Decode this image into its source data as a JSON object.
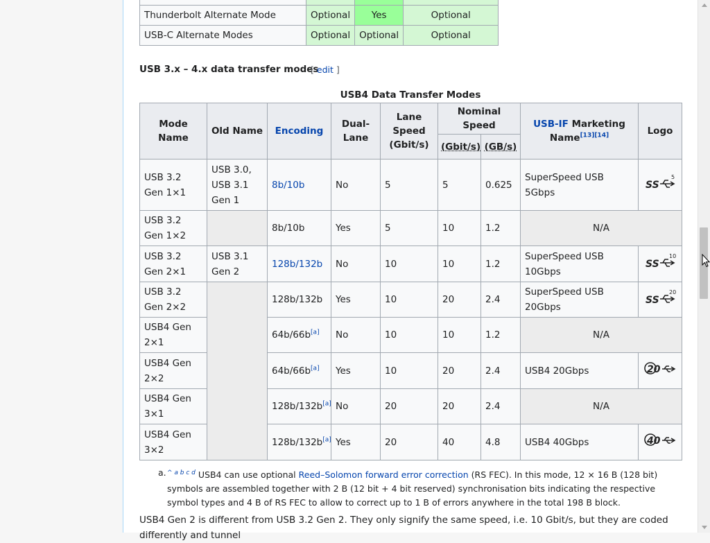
{
  "top_table": {
    "rows": [
      {
        "feature": "Thunderbolt Alternate Mode",
        "c1": "Optional",
        "c2": "Yes",
        "c3": "Optional"
      },
      {
        "feature": "USB-C Alternate Modes",
        "c1": "Optional",
        "c2": "Optional",
        "c3": "Optional"
      }
    ]
  },
  "section": {
    "heading": "USB 3.x – 4.x data transfer modes",
    "edit_open": "[",
    "edit_label": "edit",
    "edit_close": "]"
  },
  "usb_table": {
    "caption": "USB4 Data Transfer Modes",
    "headers": {
      "mode_name": "Mode Name",
      "old_name": "Old Name",
      "encoding": "Encoding",
      "dual_lane": "Dual-Lane",
      "lane_speed": "Lane Speed (Gbit/s)",
      "nominal_speed": "Nominal Speed",
      "gbits": "(Gbit/s)",
      "gbytes": "(GB/s)",
      "marketing_link": "USB-IF",
      "marketing_rest": "Marketing Name",
      "marketing_refs": "[13][14]",
      "logo": "Logo"
    },
    "na_label": "N/A",
    "rows": [
      {
        "mode": "USB 3.2 Gen 1×1",
        "old": "USB 3.0, USB 3.1 Gen 1",
        "enc": "8b/10b",
        "enc_ref": "",
        "dual": "No",
        "lane": "5",
        "gbit": "5",
        "gbyte": "0.625",
        "market": "SuperSpeed USB 5Gbps",
        "logo_num": "5"
      },
      {
        "mode": "USB 3.2 Gen 1×2",
        "old": "",
        "enc": "8b/10b",
        "enc_ref": "",
        "dual": "Yes",
        "lane": "5",
        "gbit": "10",
        "gbyte": "1.2",
        "market": "",
        "logo_num": ""
      },
      {
        "mode": "USB 3.2 Gen 2×1",
        "old": "USB 3.1 Gen 2",
        "enc": "128b/132b",
        "enc_ref": "",
        "dual": "No",
        "lane": "10",
        "gbit": "10",
        "gbyte": "1.2",
        "market": "SuperSpeed USB 10Gbps",
        "logo_num": "10"
      },
      {
        "mode": "USB 3.2 Gen 2×2",
        "old": "",
        "enc": "128b/132b",
        "enc_ref": "",
        "dual": "Yes",
        "lane": "10",
        "gbit": "20",
        "gbyte": "2.4",
        "market": "SuperSpeed USB 20Gbps",
        "logo_num": "20"
      },
      {
        "mode": "USB4 Gen 2×1",
        "old": "",
        "enc": "64b/66b",
        "enc_ref": "[a]",
        "dual": "No",
        "lane": "10",
        "gbit": "10",
        "gbyte": "1.2",
        "market": "",
        "logo_num": ""
      },
      {
        "mode": "USB4 Gen 2×2",
        "old": "",
        "enc": "64b/66b",
        "enc_ref": "[a]",
        "dual": "Yes",
        "lane": "10",
        "gbit": "20",
        "gbyte": "2.4",
        "market": "USB4 20Gbps",
        "logo_num": "20"
      },
      {
        "mode": "USB4 Gen 3×1",
        "old": "",
        "enc": "128b/132b",
        "enc_ref": "[a]",
        "dual": "No",
        "lane": "20",
        "gbit": "20",
        "gbyte": "2.4",
        "market": "",
        "logo_num": ""
      },
      {
        "mode": "USB4 Gen 3×2",
        "old": "",
        "enc": "128b/132b",
        "enc_ref": "[a]",
        "dual": "Yes",
        "lane": "20",
        "gbit": "40",
        "gbyte": "4.8",
        "market": "USB4 40Gbps",
        "logo_num": "40"
      }
    ]
  },
  "footnote": {
    "marker": "a.",
    "carets": "^ a b c d",
    "pre": "USB4 can use optional",
    "link": "Reed–Solomon forward error correction",
    "post": "(RS FEC). In this mode, 12 × 16 B (128 bit) symbols are assembled together with 2 B (12 bit + 4 bit reserved) synchronisation bits indicating the respective symbol types and 4 B of RS FEC to allow to correct up to 1 B of errors anywhere in the total 198 B block."
  },
  "paragraph": "USB4 Gen 2 is different from USB 3.2 Gen 2. They only signify the same speed, i.e. 10 Gbit/s, but they are coded differently and tunnel",
  "colors": {
    "link": "#0645ad",
    "optional_bg": "#d4f7d4",
    "yes_bg": "#99ff99",
    "header_bg": "#eaecf0",
    "na_bg": "#ececec"
  }
}
